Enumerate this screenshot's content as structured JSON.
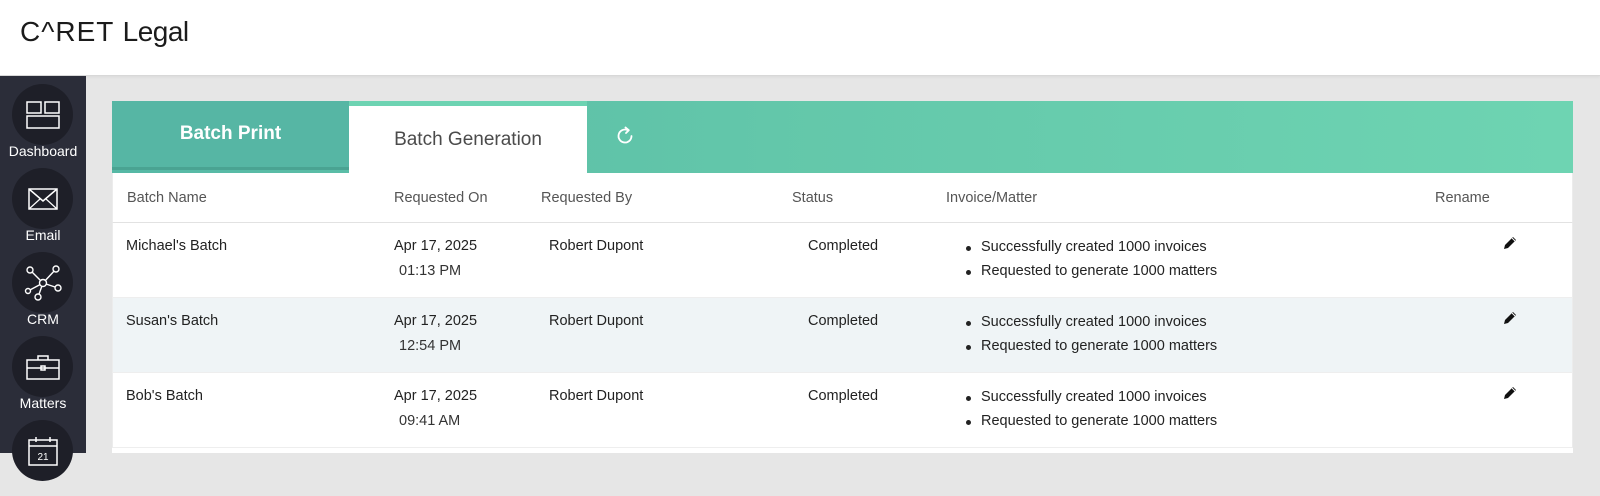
{
  "header": {
    "logo_brand": "C^RET",
    "logo_product": "Legal"
  },
  "sidebar": {
    "items": [
      {
        "label": "Dashboard",
        "icon": "dashboard-icon"
      },
      {
        "label": "Email",
        "icon": "envelope-icon"
      },
      {
        "label": "CRM",
        "icon": "network-icon"
      },
      {
        "label": "Matters",
        "icon": "briefcase-icon"
      },
      {
        "label": "",
        "icon": "calendar-icon",
        "calendar_day": "21"
      }
    ]
  },
  "tabs": {
    "batch_print": "Batch Print",
    "batch_generation": "Batch Generation",
    "refresh_icon": "refresh-icon",
    "accent_color": "#63c7aa"
  },
  "table": {
    "columns": [
      "Batch Name",
      "Requested On",
      "Requested By",
      "Status",
      "Invoice/Matter",
      "Rename"
    ],
    "rows": [
      {
        "name": "Michael's Batch",
        "date": "Apr 17, 2025",
        "time": "01:13 PM",
        "requested_by": "Robert Dupont",
        "status": "Completed",
        "details": [
          "Successfully created 1000 invoices",
          "Requested to generate 1000 matters"
        ],
        "rename_icon": "pencil-icon"
      },
      {
        "name": "Susan's Batch",
        "date": "Apr 17, 2025",
        "time": "12:54 PM",
        "requested_by": "Robert Dupont",
        "status": "Completed",
        "details": [
          "Successfully created 1000 invoices",
          "Requested to generate 1000 matters"
        ],
        "rename_icon": "pencil-icon"
      },
      {
        "name": "Bob's Batch",
        "date": "Apr 17, 2025",
        "time": "09:41 AM",
        "requested_by": "Robert Dupont",
        "status": "Completed",
        "details": [
          "Successfully created 1000 invoices",
          "Requested to generate 1000 matters"
        ],
        "rename_icon": "pencil-icon"
      }
    ]
  }
}
